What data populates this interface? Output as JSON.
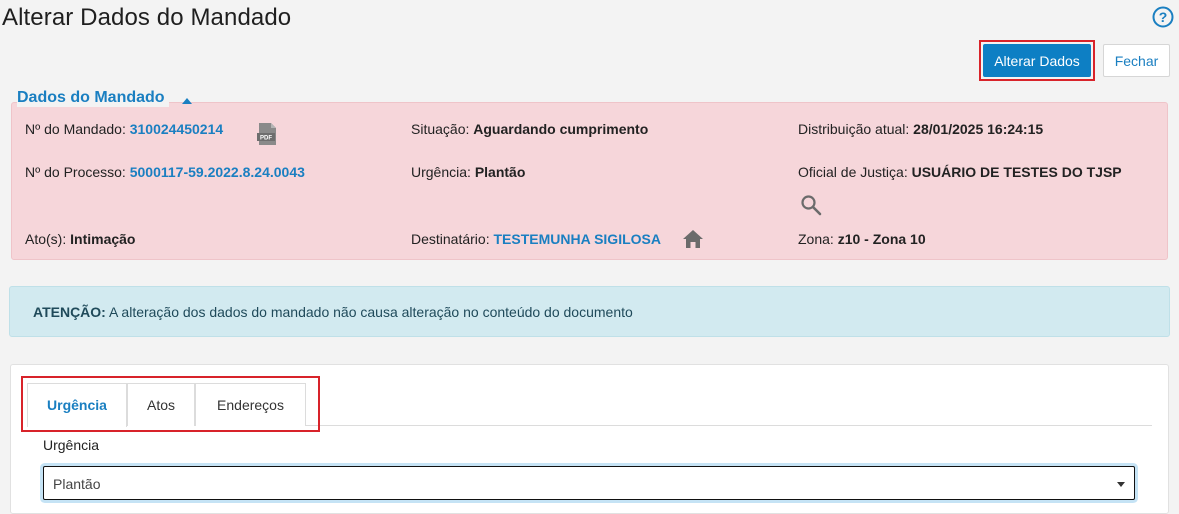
{
  "header": {
    "title": "Alterar Dados do Mandado",
    "primary_button": "Alterar Dados",
    "secondary_button": "Fechar"
  },
  "section": {
    "legend": "Dados do Mandado"
  },
  "fields": {
    "numero_mandado_label": "Nº do Mandado:",
    "numero_mandado_value": "310024450214",
    "situacao_label": "Situação:",
    "situacao_value": "Aguardando cumprimento",
    "distribuicao_label": "Distribuição atual:",
    "distribuicao_value": "28/01/2025 16:24:15",
    "numero_processo_label": "Nº do Processo:",
    "numero_processo_value": "5000117-59.2022.8.24.0043",
    "urgencia_label": "Urgência:",
    "urgencia_value": "Plantão",
    "oficial_label": "Oficial de Justiça:",
    "oficial_value": "USUÁRIO DE TESTES DO TJSP",
    "atos_label": "Ato(s):",
    "atos_value": "Intimação",
    "destinatario_label": "Destinatário:",
    "destinatario_value": "TESTEMUNHA SIGILOSA",
    "zona_label": "Zona:",
    "zona_value": "z10 - Zona 10"
  },
  "alert": {
    "strong": "ATENÇÃO:",
    "text": " A alteração dos dados do mandado não causa alteração no conteúdo do documento"
  },
  "tabs": [
    {
      "label": "Urgência"
    },
    {
      "label": "Atos"
    },
    {
      "label": "Endereços"
    }
  ],
  "form": {
    "urgencia_label": "Urgência",
    "urgencia_selected": "Plantão"
  },
  "icons": {
    "help": "help-icon",
    "pdf": "pdf-icon",
    "home": "home-icon",
    "search": "search-icon"
  },
  "colors": {
    "accent": "#1a7fc1",
    "primary_button": "#0d7fc4",
    "panel_bg": "#f6d6da",
    "alert_bg": "#d2eaf0",
    "highlight_outline": "#d8232a"
  }
}
